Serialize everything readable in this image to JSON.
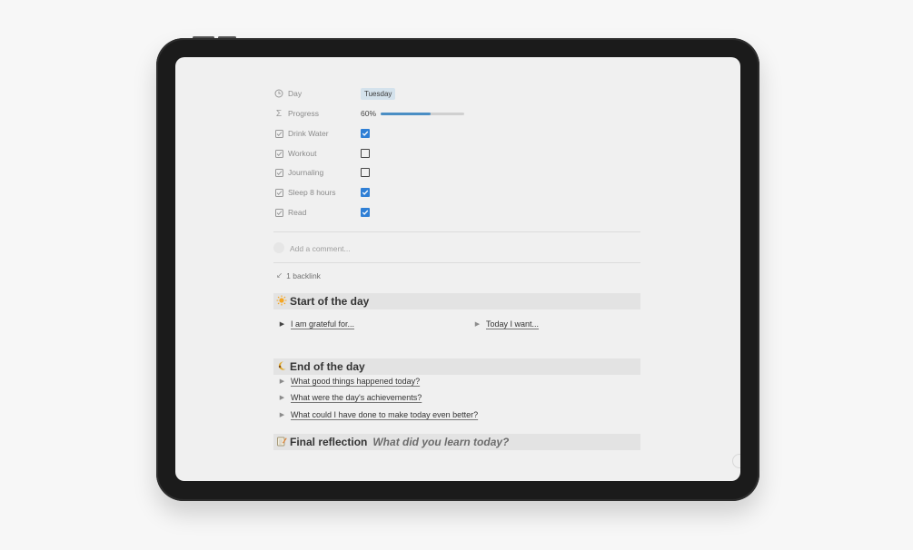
{
  "properties": [
    {
      "icon": "clock-icon",
      "label": "Day",
      "type": "tag",
      "value": "Tuesday"
    },
    {
      "icon": "sigma-icon",
      "label": "Progress",
      "type": "progress",
      "value": "60%",
      "fraction": 0.6
    },
    {
      "icon": "checkbox-icon",
      "label": "Drink Water",
      "type": "checkbox",
      "checked": true
    },
    {
      "icon": "checkbox-icon",
      "label": "Workout",
      "type": "checkbox",
      "checked": false
    },
    {
      "icon": "checkbox-icon",
      "label": "Journaling",
      "type": "checkbox",
      "checked": false
    },
    {
      "icon": "checkbox-icon",
      "label": "Sleep 8 hours",
      "type": "checkbox",
      "checked": true
    },
    {
      "icon": "checkbox-icon",
      "label": "Read",
      "type": "checkbox",
      "checked": true
    }
  ],
  "comment": {
    "placeholder": "Add a comment..."
  },
  "backlink": {
    "label": "1 backlink"
  },
  "start_section": {
    "emoji": "sun-icon",
    "title": "Start of the day",
    "toggles": [
      {
        "label": "I am grateful for..."
      },
      {
        "label": "Today I want..."
      }
    ]
  },
  "end_section": {
    "emoji": "moon-icon",
    "title": "End of the day",
    "toggles": [
      {
        "label": "What good things happened today?"
      },
      {
        "label": "What were the day's achievements?"
      },
      {
        "label": "What could I have done to make today even better?"
      }
    ]
  },
  "final_section": {
    "emoji": "memo-icon",
    "title": "Final reflection",
    "subtitle": "What did you learn today?"
  },
  "colors": {
    "accent": "#2f7fd5",
    "progress": "#4a8ec4",
    "tag_bg": "#d4e2ec",
    "heading_bg": "#e3e3e3"
  }
}
